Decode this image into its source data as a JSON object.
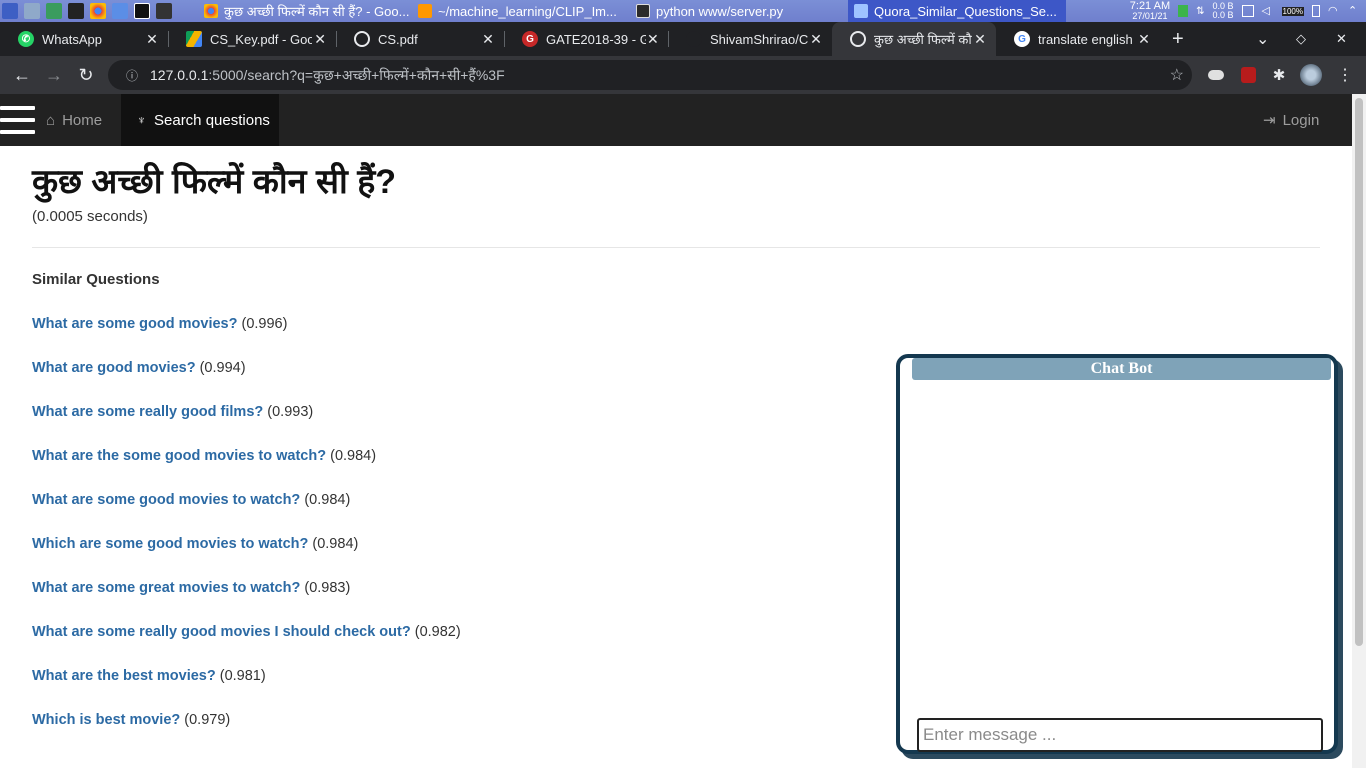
{
  "taskbar": {
    "tasks": [
      {
        "label": "कुछ अच्छी फिल्में कौन सी हैं? - Goo...",
        "color": "#4285f4",
        "active": false
      },
      {
        "label": "~/machine_learning/CLIP_Im...",
        "color": "#ff9800",
        "active": false
      },
      {
        "label": "python www/server.py",
        "color": "#2b2b2b",
        "active": false
      },
      {
        "label": "Quora_Similar_Questions_Se...",
        "color": "#3d6fd6",
        "active": true
      }
    ],
    "clock_time": "7:21 AM",
    "clock_date": "27/01/21",
    "net_up": "0.0 B",
    "net_down": "0.0 B",
    "battery": "100%"
  },
  "tabs": [
    {
      "title": "WhatsApp",
      "icon": "whatsapp-icon",
      "color": "#25d366"
    },
    {
      "title": "CS_Key.pdf - Goo",
      "icon": "google-drive-icon",
      "color": "#f4b400"
    },
    {
      "title": "CS.pdf",
      "icon": "globe-icon",
      "color": "#e8eaed"
    },
    {
      "title": "GATE2018-39 - GA",
      "icon": "gate-icon",
      "color": "#c62828"
    },
    {
      "title": "ShivamShrirao/C",
      "icon": "github-icon",
      "color": "#202124"
    },
    {
      "title": "कुछ अच्छी फिल्में कौ",
      "icon": "globe-icon",
      "color": "#e8eaed"
    },
    {
      "title": "translate english",
      "icon": "google-icon",
      "color": "#ffffff"
    }
  ],
  "address": {
    "host": "127.0.0.1",
    "path": ":5000/search?q=कुछ+अच्छी+फिल्में+कौन+सी+हैं%3F"
  },
  "navbar": {
    "home_label": "Home",
    "search_label": "Search questions",
    "login_label": "Login"
  },
  "query": {
    "title": "कुछ अच्छी फिल्में कौन सी हैं?",
    "timing": "(0.0005 seconds)",
    "similar_heading": "Similar Questions"
  },
  "results": [
    {
      "question": "What are some good movies?",
      "score": "(0.996)"
    },
    {
      "question": "What are good movies?",
      "score": "(0.994)"
    },
    {
      "question": "What are some really good films?",
      "score": "(0.993)"
    },
    {
      "question": "What are the some good movies to watch?",
      "score": "(0.984)"
    },
    {
      "question": "What are some good movies to watch?",
      "score": "(0.984)"
    },
    {
      "question": "Which are some good movies to watch?",
      "score": "(0.984)"
    },
    {
      "question": "What are some great movies to watch?",
      "score": "(0.983)"
    },
    {
      "question": "What are some really good movies I should check out?",
      "score": "(0.982)"
    },
    {
      "question": "What are the best movies?",
      "score": "(0.981)"
    },
    {
      "question": "Which is best movie?",
      "score": "(0.979)"
    }
  ],
  "chat": {
    "title": "Chat Bot",
    "placeholder": "Enter message ..."
  }
}
